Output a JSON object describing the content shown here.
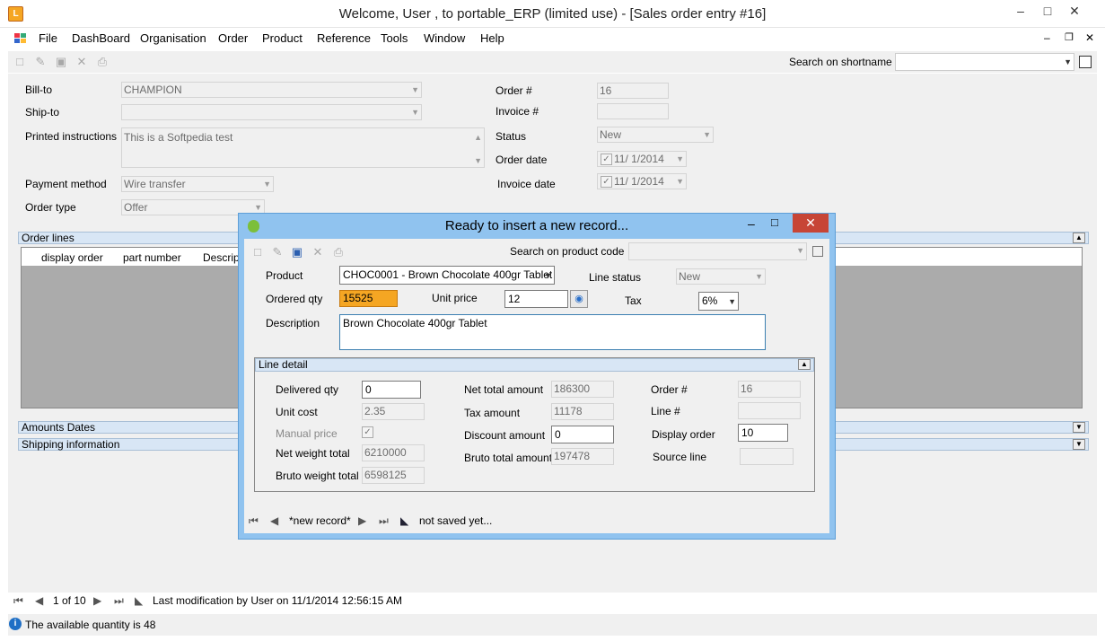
{
  "window": {
    "title": "Welcome, User , to portable_ERP (limited use) - [Sales order entry #16]",
    "app_icon": "L"
  },
  "menu": [
    "File",
    "DashBoard",
    "Organisation",
    "Order",
    "Product",
    "Reference",
    "Tools",
    "Window",
    "Help"
  ],
  "toolbar": {
    "search_label": "Search on shortname",
    "search_value": ""
  },
  "form": {
    "billto_label": "Bill-to",
    "billto_value": "CHAMPION",
    "shipto_label": "Ship-to",
    "shipto_value": "",
    "printed_label": "Printed instructions",
    "printed_value": "This is a Softpedia test",
    "payment_label": "Payment method",
    "payment_value": "Wire transfer",
    "ordertype_label": "Order type",
    "ordertype_value": "Offer",
    "order_no_label": "Order #",
    "order_no_value": "16",
    "invoice_no_label": "Invoice #",
    "invoice_no_value": "",
    "status_label": "Status",
    "status_value": "New",
    "orderdate_label": "Order date",
    "orderdate_value": "11/  1/2014",
    "invoicedate_label": "Invoice date",
    "invoicedate_value": "11/  1/2014"
  },
  "sections": {
    "order_lines": "Order lines",
    "amounts": "Amounts  Dates",
    "shipping": "Shipping information"
  },
  "grid": {
    "columns": [
      "display order",
      "part number",
      "Descrip"
    ]
  },
  "nav": {
    "position": "1 of 10",
    "modification": "Last modification by User on 11/1/2014 12:56:15 AM"
  },
  "status": {
    "message": "The available quantity is 48"
  },
  "dialog": {
    "title": "Ready to insert a new record...",
    "search_label": "Search on product code",
    "product_label": "Product",
    "product_value": "CHOC0001 - Brown Chocolate 400gr Tablet",
    "linestatus_label": "Line status",
    "linestatus_value": "New",
    "orderedqty_label": "Ordered qty",
    "orderedqty_value": "15525",
    "unitprice_label": "Unit price",
    "unitprice_value": "12",
    "tax_label": "Tax",
    "tax_value": "6%",
    "desc_label": "Description",
    "desc_value": "Brown Chocolate 400gr Tablet",
    "line_detail": "Line detail",
    "delivered_label": "Delivered qty",
    "delivered_value": "0",
    "unitcost_label": "Unit cost",
    "unitcost_value": "2.35",
    "manual_label": "Manual price",
    "netweight_label": "Net weight total",
    "netweight_value": "6210000",
    "brutoweight_label": "Bruto weight total",
    "brutoweight_value": "6598125",
    "nettotal_label": "Net total amount",
    "nettotal_value": "186300",
    "taxamount_label": "Tax amount",
    "taxamount_value": "11178",
    "discount_label": "Discount amount",
    "discount_value": "0",
    "brutototal_label": "Bruto total amount",
    "brutototal_value": "197478",
    "orderno_label": "Order #",
    "orderno_value": "16",
    "lineno_label": "Line #",
    "lineno_value": "",
    "displayorder_label": "Display order",
    "displayorder_value": "10",
    "sourceline_label": "Source line",
    "sourceline_value": "",
    "nav_record": "*new record*",
    "nav_status": "not saved yet..."
  },
  "colors": {
    "accent": "#f5a623",
    "dialog_border": "#90c3ef",
    "close": "#c74536",
    "section": "#d8e6f5"
  }
}
